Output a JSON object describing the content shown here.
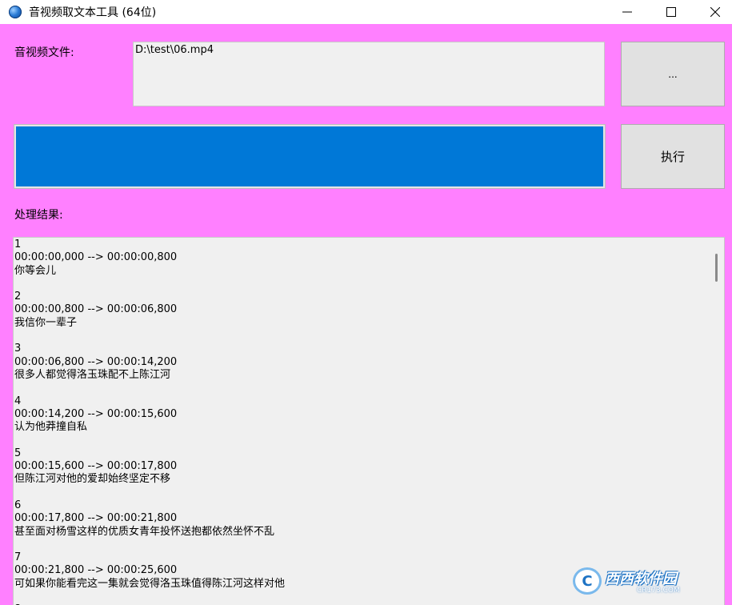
{
  "window": {
    "title": "音视频取文本工具 (64位)"
  },
  "file": {
    "label": "音视频文件:",
    "path": "D:\\test\\06.mp4",
    "browse_label": "..."
  },
  "progress": {
    "value": 1.0,
    "color": "#0078d7"
  },
  "run_button": {
    "label": "执行"
  },
  "result": {
    "label": "处理结果:",
    "entries": [
      {
        "index": "1",
        "time": "00:00:00,000 --> 00:00:00,800",
        "text": "你等会儿"
      },
      {
        "index": "2",
        "time": "00:00:00,800 --> 00:00:06,800",
        "text": "我信你一辈子"
      },
      {
        "index": "3",
        "time": "00:00:06,800 --> 00:00:14,200",
        "text": "很多人都觉得洛玉珠配不上陈江河"
      },
      {
        "index": "4",
        "time": "00:00:14,200 --> 00:00:15,600",
        "text": "认为他莽撞自私"
      },
      {
        "index": "5",
        "time": "00:00:15,600 --> 00:00:17,800",
        "text": "但陈江河对他的爱却始终坚定不移"
      },
      {
        "index": "6",
        "time": "00:00:17,800 --> 00:00:21,800",
        "text": "甚至面对杨雪这样的优质女青年投怀送抱都依然坐怀不乱"
      },
      {
        "index": "7",
        "time": "00:00:21,800 --> 00:00:25,600",
        "text": "可如果你能看完这一集就会觉得洛玉珠值得陈江河这样对他"
      },
      {
        "index": "8",
        "time": "",
        "text": ""
      }
    ]
  },
  "watermark": {
    "logo_letter": "C",
    "main": "西西软件园",
    "sub": "CR173.COM"
  },
  "colors": {
    "window_bg": "#ff80ff",
    "accent": "#0078d7"
  }
}
